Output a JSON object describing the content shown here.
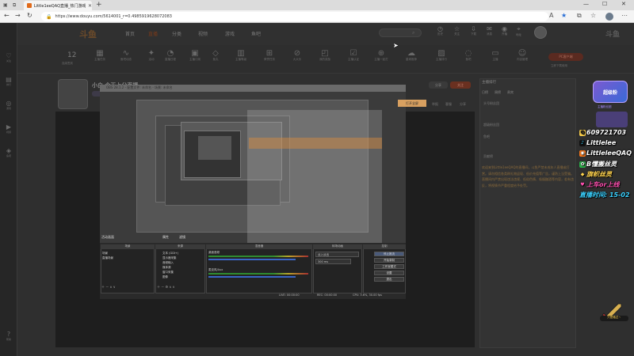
{
  "browser": {
    "tab_title": "Little1eeQAQ直播_热门游戏直播",
    "url": "https://www.douyu.com/5614001_r=0.4985919628072083"
  },
  "site": {
    "logo": "斗鱼",
    "nav": [
      "首页",
      "直播",
      "分类",
      "视频",
      "游戏",
      "鱼吧"
    ],
    "header_icons": [
      {
        "icon": "history-icon",
        "label": "历史"
      },
      {
        "icon": "star-icon",
        "label": "关注"
      },
      {
        "icon": "download-icon",
        "label": "下载"
      },
      {
        "icon": "bell-icon",
        "label": "消息"
      },
      {
        "icon": "broadcast-icon",
        "label": "开播"
      },
      {
        "icon": "location-icon",
        "label": "地址"
      }
    ],
    "brand_right": "斗鱼"
  },
  "categories": {
    "day_count": "12",
    "day_label": "连续签到",
    "items": [
      "主播任务",
      "鱼吧动态",
      "活动",
      "直播日程",
      "主播订阅",
      "鱼丸",
      "主播等级",
      "荣誉任务",
      "大大乐",
      "我的奖励",
      "主播认证",
      "主播一起打",
      "星球推荐",
      "主播排行",
      "鱼吧",
      "主播",
      "内容管理"
    ],
    "pc_button": "PC客户端",
    "pc_sub": "立即下载使用"
  },
  "room": {
    "title": "小白 今天上分直播",
    "buttons": [
      "分享",
      "关注"
    ],
    "small_labels": [
      "举报",
      "客服",
      "分享"
    ]
  },
  "stream": {
    "capture_title": "OBS 28.1.2 - 配置文件: 未命名 - 场景: 未命名",
    "top_badge": "打开全屏",
    "obs_labels": [
      "活动画面",
      "属性",
      "滤镜"
    ],
    "docks": {
      "scenes": {
        "title": "场景",
        "items": [
          "场景",
          "直播场景"
        ]
      },
      "sources": {
        "title": "来源",
        "items": [
          "文本 (GDI+)",
          "显示器采集",
          "音频输入",
          "媒体源",
          "窗口采集",
          "图像"
        ]
      },
      "mixer": {
        "title": "混音器",
        "channels": [
          "桌面音频",
          "麦克风/Aux"
        ]
      },
      "transitions": {
        "title": "转场动画",
        "items": [
          "淡入淡出",
          "300 ms"
        ]
      },
      "controls": {
        "title": "控制",
        "items": [
          "停止推流",
          "开始录制",
          "工作室模式",
          "设置",
          "退出"
        ]
      }
    },
    "status": [
      "LIVE: 00:00:00",
      "REC: 00:00:00",
      "CPU: 3.6%, 30.00 fps"
    ]
  },
  "chat": {
    "header": "主播排行",
    "tabs": [
      "日榜",
      "周榜",
      "贵宾"
    ],
    "rows": [
      "头号粉丝团",
      "超级粉丝团",
      "鱼吧",
      "贡献榜"
    ],
    "notice": "欢迎来到Little1eeQAQ的直播间，斗鱼严禁未成年人直播或打赏。请勿相信各类刷礼物返现、低价充值等广告，谨防上当受骗。直播间内严禁出现违法违规、低俗色情、吸烟酗酒等内容，若有违反，将视情节严重程度给予处罚。"
  },
  "overlay": {
    "badge": "超级粉",
    "badge_sub": "主播粉丝团",
    "qq": "609721703",
    "douyin": "Littlelee",
    "kuaishou": "LittleleeQAQ",
    "group": "B懂搬丝灵",
    "gift": "旗帜丝灵",
    "follow": "上车or上线",
    "time": "直播时间: 15-02",
    "sword_label": "只是路过丶"
  }
}
